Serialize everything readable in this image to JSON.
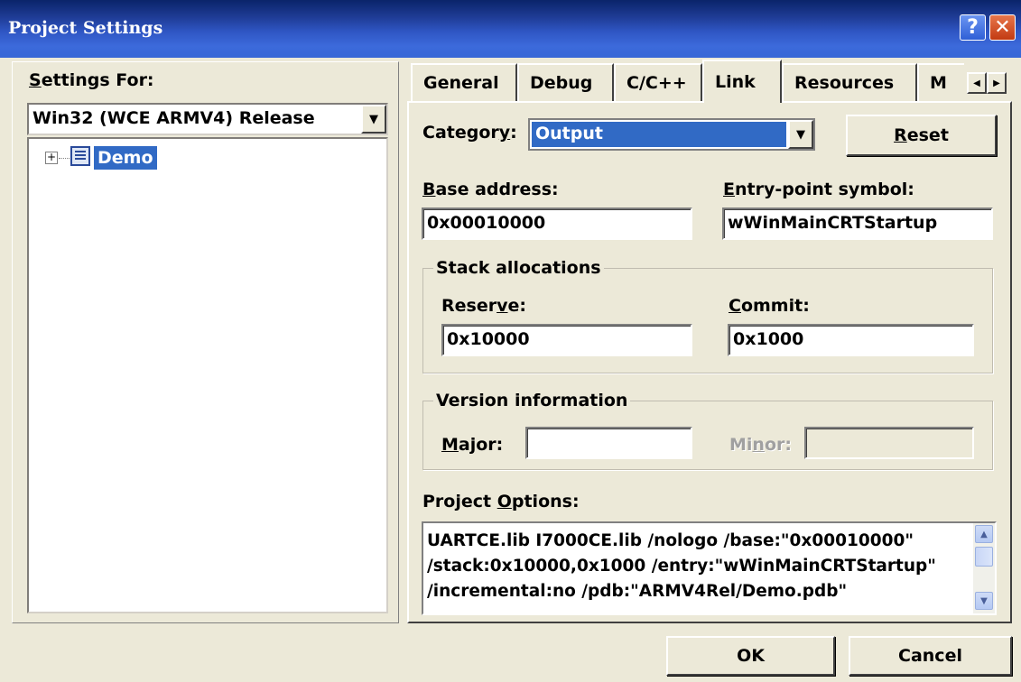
{
  "window": {
    "title": "Project Settings",
    "help_glyph": "?",
    "close_glyph": "✕"
  },
  "left": {
    "settings_for_prefix": "S",
    "settings_for_rest": "ettings For:",
    "config": "Win32 (WCE ARMV4) Release",
    "tree_item": "Demo",
    "expander": "+"
  },
  "tabs": [
    {
      "label": "General"
    },
    {
      "label": "Debug"
    },
    {
      "label": "C/C++"
    },
    {
      "label": "Link"
    },
    {
      "label": "Resources"
    },
    {
      "label": "M"
    }
  ],
  "active_tab": "Link",
  "tab_scroll": {
    "left": "◀",
    "right": "▶"
  },
  "link": {
    "category_pre": "Categor",
    "category_u": "y",
    "category_post": ":",
    "category_value": "Output",
    "reset_u": "R",
    "reset_rest": "eset",
    "base_address_u": "B",
    "base_address_rest": "ase address:",
    "base_address_value": "0x00010000",
    "entry_u": "E",
    "entry_rest": "ntry-point symbol:",
    "entry_value": "wWinMainCRTStartup",
    "stack_group": "Stack allocations",
    "reserve_pre": "Reser",
    "reserve_u": "v",
    "reserve_post": "e:",
    "reserve_value": "0x10000",
    "commit_u": "C",
    "commit_rest": "ommit:",
    "commit_value": "0x1000",
    "version_group": "Version information",
    "major_u": "M",
    "major_rest": "ajor:",
    "major_value": "",
    "minor_pre": "Mi",
    "minor_u": "n",
    "minor_post": "or:",
    "minor_value": "",
    "project_options_pre": "Project ",
    "project_options_u": "O",
    "project_options_post": "ptions:",
    "project_options_text": "UARTCE.lib I7000CE.lib /nologo /base:\"0x00010000\"\n/stack:0x10000,0x1000 /entry:\"wWinMainCRTStartup\"\n/incremental:no /pdb:\"ARMV4Rel/Demo.pdb\""
  },
  "buttons": {
    "ok": "OK",
    "cancel": "Cancel"
  },
  "colors": {
    "titlebar": "#2f56c4",
    "selection": "#316ac5",
    "face": "#ece9d8"
  }
}
